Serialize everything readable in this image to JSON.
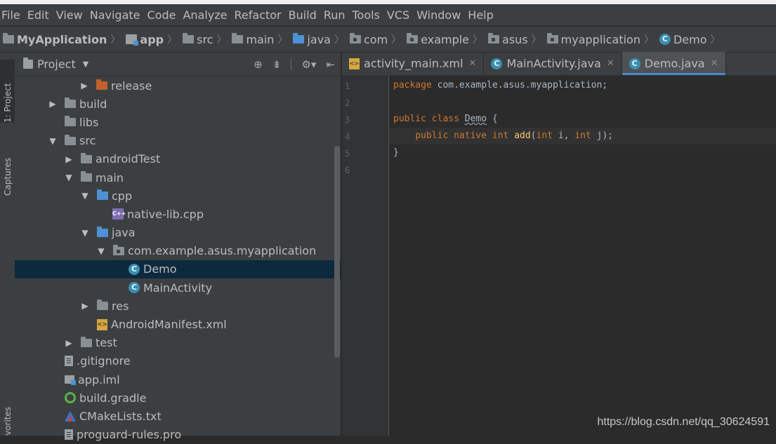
{
  "menu": [
    "File",
    "Edit",
    "View",
    "Navigate",
    "Code",
    "Analyze",
    "Refactor",
    "Build",
    "Run",
    "Tools",
    "VCS",
    "Window",
    "Help"
  ],
  "breadcrumbs": [
    {
      "label": "MyApplication",
      "icon": "project-icon",
      "bold": true
    },
    {
      "label": "app",
      "icon": "module-icon",
      "bold": true
    },
    {
      "label": "src",
      "icon": "folder-icon"
    },
    {
      "label": "main",
      "icon": "folder-icon"
    },
    {
      "label": "java",
      "icon": "source-folder-icon"
    },
    {
      "label": "com",
      "icon": "package-icon"
    },
    {
      "label": "example",
      "icon": "package-icon"
    },
    {
      "label": "asus",
      "icon": "package-icon"
    },
    {
      "label": "myapplication",
      "icon": "package-icon"
    },
    {
      "label": "Demo",
      "icon": "class-icon"
    }
  ],
  "tool_windows": {
    "project": "1: Project",
    "captures": "Captures",
    "favorites": "vorites"
  },
  "project_panel": {
    "title": "Project"
  },
  "tree": [
    {
      "label": "release",
      "arrow": "collapsed",
      "icon": "folder-orange"
    },
    {
      "label": "build",
      "arrow": "collapsed",
      "icon": "folder"
    },
    {
      "label": "libs",
      "arrow": "none",
      "icon": "folder"
    },
    {
      "label": "src",
      "arrow": "expanded",
      "icon": "folder"
    },
    {
      "label": "androidTest",
      "arrow": "collapsed",
      "icon": "folder"
    },
    {
      "label": "main",
      "arrow": "expanded",
      "icon": "folder"
    },
    {
      "label": "cpp",
      "arrow": "expanded",
      "icon": "folder-blue"
    },
    {
      "label": "native-lib.cpp",
      "arrow": "none",
      "icon": "cpp-file"
    },
    {
      "label": "java",
      "arrow": "expanded",
      "icon": "folder-blue"
    },
    {
      "label": "com.example.asus.myapplication",
      "arrow": "expanded",
      "icon": "package"
    },
    {
      "label": "Demo",
      "arrow": "none",
      "icon": "class",
      "selected": true
    },
    {
      "label": "MainActivity",
      "arrow": "none",
      "icon": "class"
    },
    {
      "label": "res",
      "arrow": "collapsed",
      "icon": "res-folder"
    },
    {
      "label": "AndroidManifest.xml",
      "arrow": "none",
      "icon": "manifest"
    },
    {
      "label": "test",
      "arrow": "collapsed",
      "icon": "folder"
    },
    {
      "label": ".gitignore",
      "arrow": "none",
      "icon": "text-file"
    },
    {
      "label": "app.iml",
      "arrow": "none",
      "icon": "module-file"
    },
    {
      "label": "build.gradle",
      "arrow": "none",
      "icon": "gradle"
    },
    {
      "label": "CMakeLists.txt",
      "arrow": "none",
      "icon": "cmake"
    },
    {
      "label": "proguard-rules.pro",
      "arrow": "none",
      "icon": "text-file"
    }
  ],
  "editor_tabs": [
    {
      "label": "activity_main.xml",
      "icon": "xml-layout"
    },
    {
      "label": "MainActivity.java",
      "icon": "class"
    },
    {
      "label": "Demo.java",
      "icon": "class",
      "active": true
    }
  ],
  "line_numbers": [
    "1",
    "2",
    "3",
    "4",
    "5",
    "6"
  ],
  "code": {
    "l1_kw": "package",
    "l1_rest": " com.example.asus.myapplication;",
    "l3_kw": "public class",
    "l3_name": "Demo",
    "l3_rest": " {",
    "l4_indent": "    ",
    "l4_kw1": "public native int",
    "l4_fn": "add",
    "l4_p1": "(",
    "l4_kw2": "int",
    "l4_p2": " i, ",
    "l4_kw3": "int",
    "l4_p3": " j);",
    "l5": "}"
  },
  "watermark": "https://blog.csdn.net/qq_30624591"
}
